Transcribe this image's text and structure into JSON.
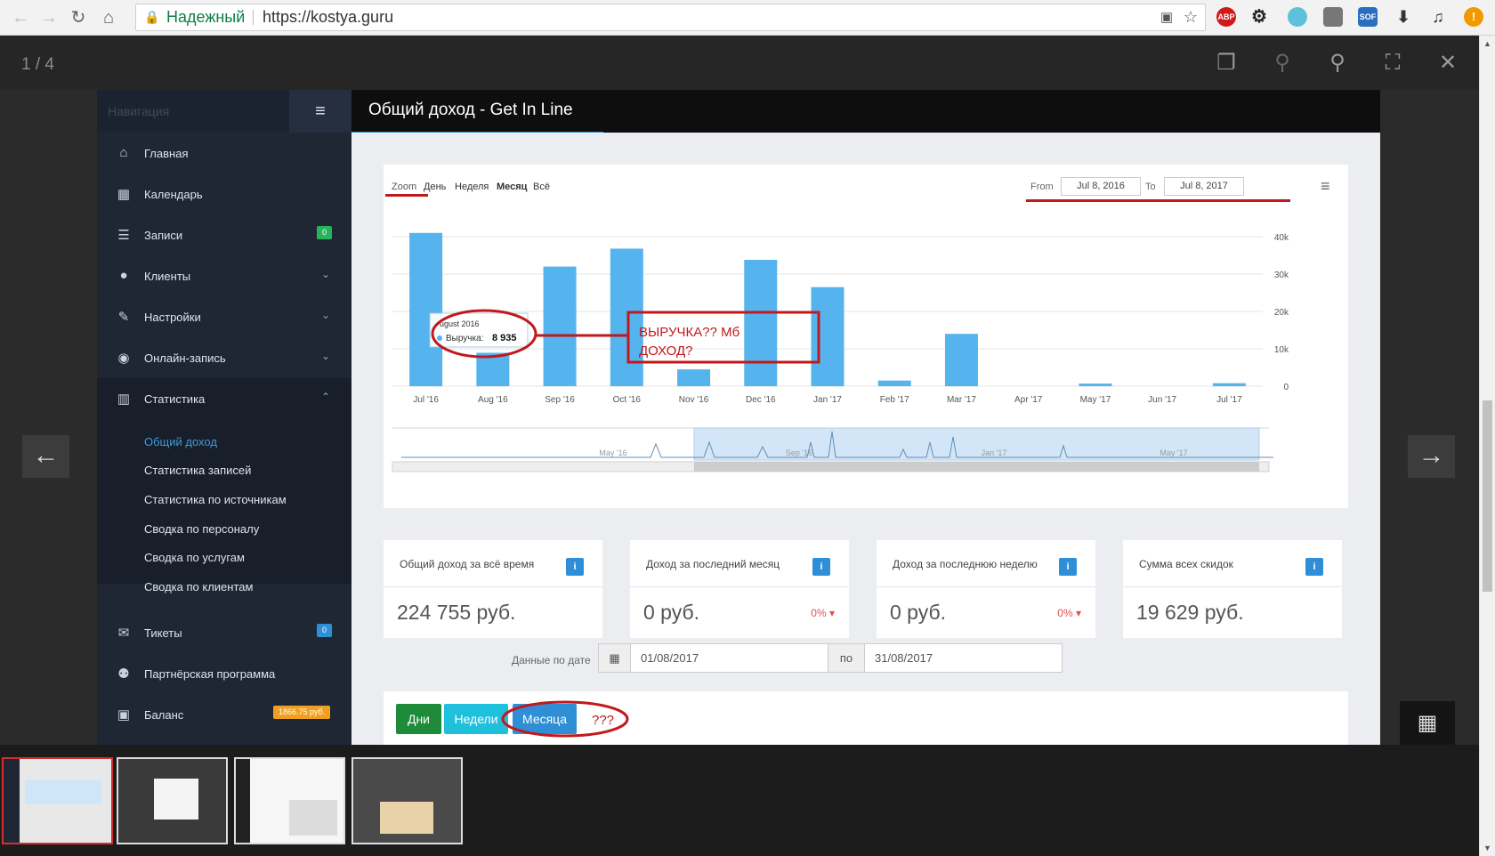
{
  "browser": {
    "secure_label": "Надежный",
    "url": "https://kostya.guru",
    "extensions": [
      {
        "name": "adblock-plus",
        "label": "ABP",
        "color": "#d01a1a"
      },
      {
        "name": "sof",
        "label": "SOF",
        "color": "#2a6ebf"
      }
    ]
  },
  "lightbox": {
    "counter": "1 / 4",
    "thumbnails": 4,
    "active_thumbnail": 1
  },
  "sidebar": {
    "heading": "Навигация",
    "items": [
      {
        "label": "Главная",
        "icon": "home-icon"
      },
      {
        "label": "Календарь",
        "icon": "calendar-icon"
      },
      {
        "label": "Записи",
        "icon": "list-icon",
        "badge": "0"
      },
      {
        "label": "Клиенты",
        "icon": "user-icon"
      },
      {
        "label": "Настройки",
        "icon": "wrench-icon"
      },
      {
        "label": "Онлайн-запись",
        "icon": "globe-icon"
      },
      {
        "label": "Статистика",
        "icon": "bar-chart-icon"
      }
    ],
    "stats_sub": [
      "Общий доход",
      "Статистика записей",
      "Статистика по источникам",
      "Сводка по персоналу",
      "Сводка по услугам",
      "Сводка по клиентам"
    ],
    "bottom": [
      {
        "label": "Тикеты",
        "icon": "envelope-icon",
        "badge": "0"
      },
      {
        "label": "Партнёрская программа",
        "icon": "users-icon"
      },
      {
        "label": "Баланс",
        "icon": "money-icon",
        "badge": "1866.75 руб."
      }
    ]
  },
  "page": {
    "title": "Общий доход - Get In Line"
  },
  "chart_toolbar": {
    "zoom_label": "Zoom",
    "zoom_options": [
      "День",
      "Неделя",
      "Месяц",
      "Всё"
    ],
    "selected_zoom": "Месяц",
    "from_label": "From",
    "from_value": "Jul 8, 2016",
    "to_label": "To",
    "to_value": "Jul 8, 2017"
  },
  "chart_data": {
    "type": "bar",
    "categories": [
      "Jul '16",
      "Aug '16",
      "Sep '16",
      "Oct '16",
      "Nov '16",
      "Dec '16",
      "Jan '17",
      "Feb '17",
      "Mar '17",
      "Apr '17",
      "May '17",
      "Jun '17",
      "Jul '17"
    ],
    "series": [
      {
        "name": "Выручка",
        "values": [
          41000,
          8935,
          32000,
          36800,
          4500,
          33800,
          26500,
          1500,
          14000,
          0,
          700,
          0,
          800
        ]
      }
    ],
    "ylim": [
      0,
      40000
    ],
    "yticks": [
      "0",
      "10k",
      "20k",
      "30k",
      "40k"
    ],
    "grid": true,
    "bar_color": "#55b3ee",
    "tooltip": {
      "title": "ugust 2016",
      "label": "Выручка",
      "value": "8 935"
    },
    "navigator_labels": [
      "May '16",
      "Sep '16",
      "Jan '17",
      "May '17"
    ]
  },
  "annotation": {
    "text": "ВЫРУЧКА?? Мб ДОХОД?",
    "question": "???",
    "color": "#c2181b"
  },
  "stats": [
    {
      "title": "Общий доход за всё время",
      "value": "224 755 руб."
    },
    {
      "title": "Доход за последний месяц",
      "value": "0 руб.",
      "pct": "0%"
    },
    {
      "title": "Доход за последнюю неделю",
      "value": "0 руб.",
      "pct": "0%"
    },
    {
      "title": "Сумма всех скидок",
      "value": "19 629 руб."
    }
  ],
  "date_filter": {
    "label": "Данные по дате",
    "from": "01/08/2017",
    "sep": "по",
    "to": "31/08/2017"
  },
  "period_buttons": [
    {
      "label": "Дни",
      "color": "#1e8b3a"
    },
    {
      "label": "Недели",
      "color": "#1fc0dc"
    },
    {
      "label": "Месяца",
      "color": "#2f8fd6"
    }
  ]
}
